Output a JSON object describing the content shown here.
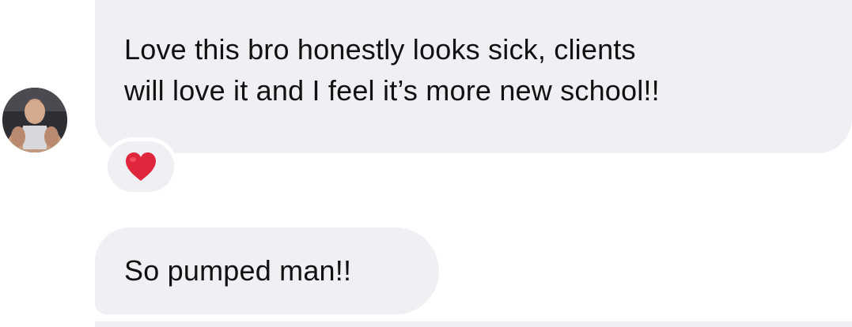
{
  "thread": {
    "messages": [
      {
        "text": "Love this bro honestly looks sick, clients\nwill love it and I feel it’s more new school!!",
        "reaction": "heart-emoji"
      },
      {
        "text": "So pumped man!!"
      }
    ]
  },
  "colors": {
    "bubble_background": "#efeff4",
    "heart": "#e0263c",
    "text": "#111111"
  },
  "icons": {
    "avatar": "profile-photo",
    "reaction": "red-heart"
  }
}
